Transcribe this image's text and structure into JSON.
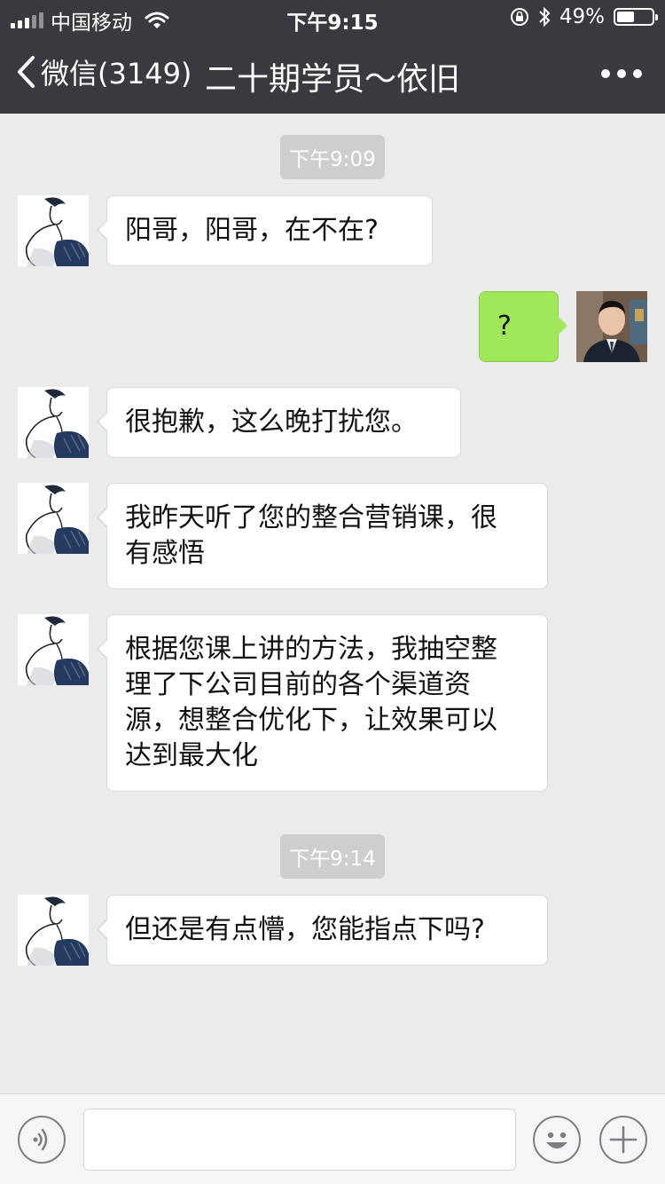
{
  "status_bar": {
    "carrier": "中国移动",
    "time": "下午9:15",
    "battery": "49%",
    "battery_level": 0.49
  },
  "header": {
    "back_label": "微信(3149)",
    "title": "二十期学员～依旧"
  },
  "messages": [
    {
      "timestamp": "下午9:09"
    },
    {
      "from": "other",
      "text": "阳哥，阳哥，在不在?"
    },
    {
      "from": "me",
      "text": "?"
    },
    {
      "from": "other",
      "text": "很抱歉，这么晚打扰您。"
    },
    {
      "from": "other",
      "lines": [
        "我昨天听了您的整合营销课，很",
        "有感悟"
      ]
    },
    {
      "from": "other",
      "lines": [
        "根据您课上讲的方法，我抽空整",
        "理了下公司目前的各个渠道资",
        "源，想整合优化下，让效果可以",
        "达到最大化"
      ]
    },
    {
      "timestamp": "下午9:14"
    },
    {
      "from": "other",
      "text": "但还是有点懵，您能指点下吗?"
    }
  ],
  "input": {
    "placeholder": ""
  },
  "icons": {
    "back": "chevron-left-icon",
    "more": "more-dots-icon",
    "voice": "voice-icon",
    "emoji": "emoji-icon",
    "add": "plus-icon"
  },
  "colors": {
    "header": "#393a3f",
    "background": "#ebebeb",
    "sent_bubble": "#a0e75a"
  }
}
